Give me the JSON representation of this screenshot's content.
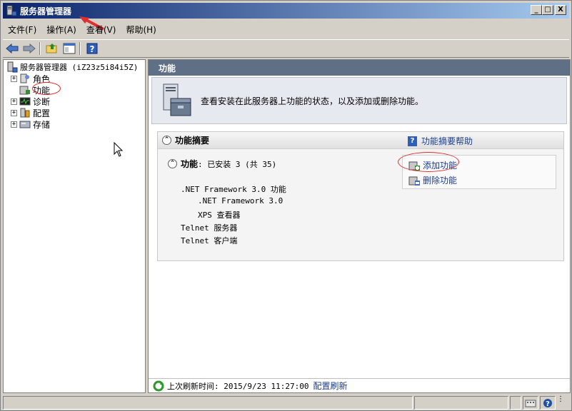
{
  "window": {
    "title": "服务器管理器",
    "controls": {
      "minimize": "_",
      "maximize": "□",
      "close": "X"
    }
  },
  "menu": [
    "文件(F)",
    "操作(A)",
    "查看(V)",
    "帮助(H)"
  ],
  "toolbar_icons": [
    "back-arrow-icon",
    "forward-arrow-icon",
    "up-folder-icon",
    "show-hide-tree-icon",
    "help-icon"
  ],
  "tree": {
    "root": "服务器管理器 (iZ23z5i84i5Z)",
    "items": [
      {
        "label": "角色",
        "expander": "+"
      },
      {
        "label": "功能",
        "expander": ""
      },
      {
        "label": "诊断",
        "expander": "+"
      },
      {
        "label": "配置",
        "expander": "+"
      },
      {
        "label": "存储",
        "expander": "+"
      }
    ]
  },
  "main": {
    "header": "功能",
    "intro": "查看安装在此服务器上功能的状态，以及添加或删除功能。",
    "summary": {
      "title": "功能摘要",
      "help_link": "功能摘要帮助",
      "installed_label": "功能",
      "installed_text": ": 已安装 3 (共 35)",
      "features": [
        ".NET Framework 3.0 功能",
        ".NET Framework 3.0",
        "XPS 查看器",
        "Telnet 服务器",
        "Telnet 客户端"
      ],
      "actions": [
        "添加功能",
        "删除功能"
      ]
    },
    "refresh": {
      "label": "上次刷新时间: 2015/9/23 11:27:00",
      "link": "配置刷新"
    }
  },
  "colors": {
    "title_gradient_start": "#0a246a",
    "title_gradient_end": "#a6caf0",
    "link": "#1a3e8c",
    "annotation_red": "#e03030",
    "pane_header": "#5f6f86"
  }
}
